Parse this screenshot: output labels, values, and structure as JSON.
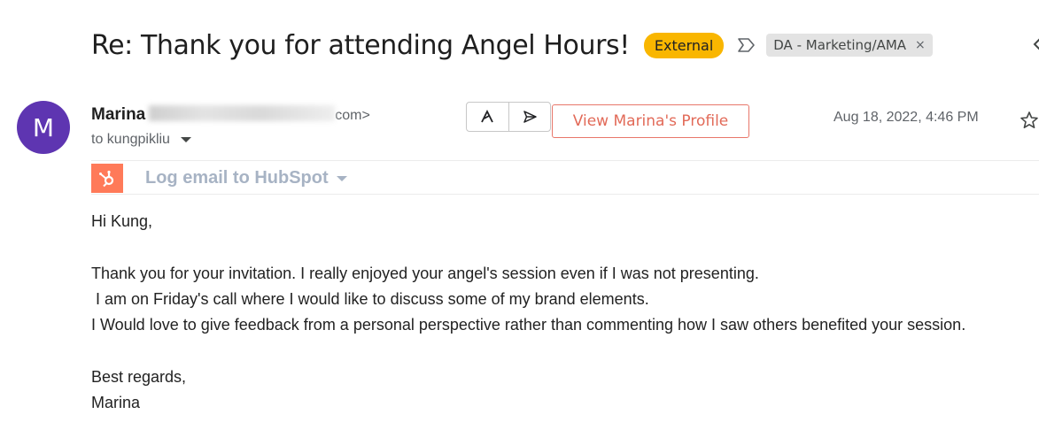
{
  "subject": {
    "title": "Re: Thank you for attending Angel Hours!",
    "badge": "External",
    "label_chip": "DA - Marketing/AMA",
    "label_chip_remove": "×"
  },
  "sender": {
    "avatar_letter": "M",
    "avatar_color": "#5e35b1",
    "name": "Marina",
    "email_suffix": "com>",
    "to_line": "to kungpikliu",
    "date": "Aug 18, 2022, 4:46 PM"
  },
  "actions": {
    "view_profile_label": "View Marina's Profile"
  },
  "hubspot": {
    "log_label": "Log email to HubSpot",
    "brand_color": "#ff7a59"
  },
  "body": {
    "greeting": "Hi Kung,",
    "line1": "Thank you for your invitation. I really enjoyed your angel's session even if I was not presenting.",
    "line2": " I am on Friday's call where I would like to discuss some of my brand elements.",
    "line3": "I Would love to give feedback from a personal perspective rather than commenting how I saw others benefited your session.",
    "signoff": "Best regards,",
    "signature": "Marina"
  },
  "icons": {
    "label_arrow": "label-arrow-icon",
    "star": "star-icon",
    "ai_assist": "ai-assist-icon",
    "send": "send-icon",
    "hubspot": "hubspot-logo-icon",
    "expand": "chevron-icon"
  }
}
